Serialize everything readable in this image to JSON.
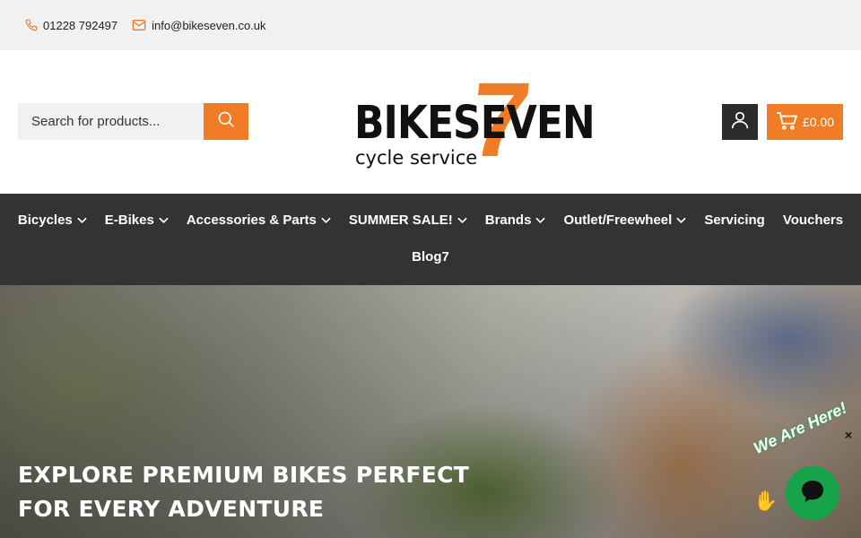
{
  "topbar": {
    "phone": "01228 792497",
    "email": "info@bikeseven.co.uk"
  },
  "search": {
    "placeholder": "Search for products..."
  },
  "logo": {
    "word": "BIKESEVEN",
    "seven": "7",
    "tagline": "cycle service"
  },
  "cart": {
    "total": "£0.00"
  },
  "nav": {
    "row1": [
      {
        "label": "Bicycles",
        "dropdown": true
      },
      {
        "label": "E-Bikes",
        "dropdown": true
      },
      {
        "label": "Accessories & Parts",
        "dropdown": true
      },
      {
        "label": "SUMMER SALE!",
        "dropdown": true
      },
      {
        "label": "Brands",
        "dropdown": true
      },
      {
        "label": "Outlet/Freewheel",
        "dropdown": true
      },
      {
        "label": "Servicing",
        "dropdown": false
      },
      {
        "label": "Vouchers",
        "dropdown": false
      }
    ],
    "row2": [
      {
        "label": "Blog7",
        "dropdown": false
      }
    ]
  },
  "hero": {
    "title": "EXPLORE PREMIUM BIKES PERFECT FOR EVERY ADVENTURE"
  },
  "chat": {
    "teaser": "We Are Here!",
    "close": "×"
  },
  "colors": {
    "accent": "#f07d26",
    "nav_bg": "#333333",
    "topbar_bg": "#f1f1f1",
    "chat_green": "#17a34a"
  }
}
